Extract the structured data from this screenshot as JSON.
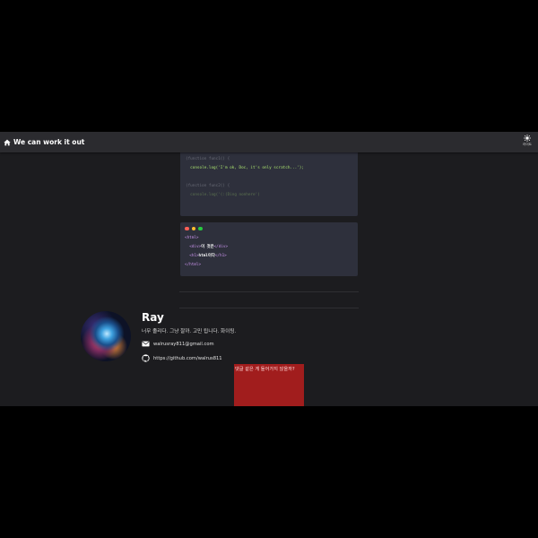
{
  "header": {
    "title": "We can work it out",
    "theme_label": "라이트"
  },
  "code_block_1": {
    "lines": [
      "(function func1() {",
      "  console.log('I'm ok, Doc, it's only scratch...');",
      "",
      "(function func2() {",
      "  console.log('(:(Ding nonhere')"
    ]
  },
  "code_block_2": {
    "dots": [
      "#ff5f56",
      "#ffbd2e",
      "#27c93f"
    ],
    "lines": {
      "l1": "<html>",
      "l2_open": "<div>",
      "l2_text": "이 것은",
      "l2_close": "</div>",
      "l3_open": "<h1>",
      "l3_text": "html이다",
      "l3_close": "</h1>",
      "l4": "</html>"
    }
  },
  "author": {
    "name": "Ray",
    "bio": "너무 졸리다. 그냥 잘까. 고민 됩니다. 화이팅.",
    "email": "walrusray811@gmail.com",
    "github": "https://github.com/walrus811"
  },
  "comments": {
    "placeholder_text": "댓글 같은 게 들어가지 않을까?",
    "color": "#a11d1d"
  }
}
